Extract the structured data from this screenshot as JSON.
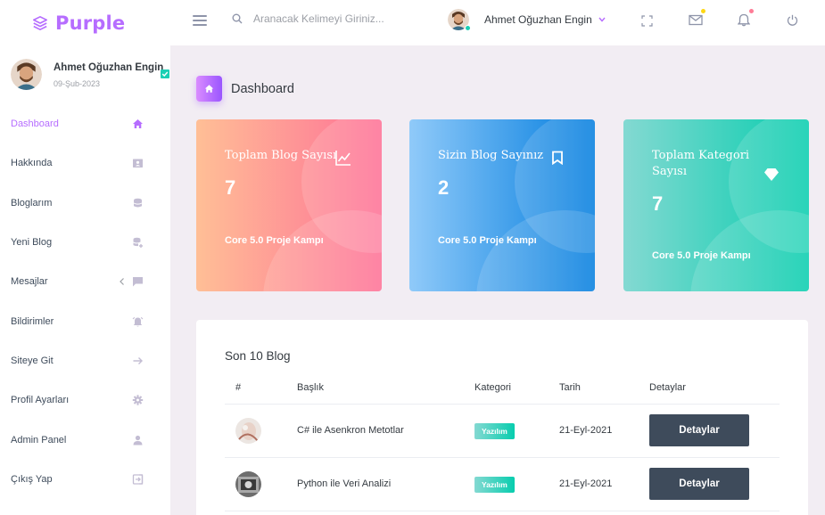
{
  "brand": {
    "name": "Purple",
    "accent": "#b66dff"
  },
  "search": {
    "placeholder": "Aranacak Kelimeyi Giriniz..."
  },
  "user": {
    "name": "Ahmet Oğuzhan Engin",
    "date": "09-Şub-2023"
  },
  "navbar": {
    "icons": [
      "menu-icon",
      "search-icon",
      "fullscreen-icon",
      "mail-icon",
      "bell-icon",
      "power-icon"
    ],
    "mail_badge_color": "#fed713",
    "bell_badge_color": "#fe7c96"
  },
  "sidebar": {
    "items": [
      {
        "label": "Dashboard",
        "icon": "home-icon",
        "active": true
      },
      {
        "label": "Hakkında",
        "icon": "contact-card-icon"
      },
      {
        "label": "Bloglarım",
        "icon": "database-icon"
      },
      {
        "label": "Yeni Blog",
        "icon": "database-plus-icon"
      },
      {
        "label": "Mesajlar",
        "icon": "message-icon"
      },
      {
        "label": "Bildirimler",
        "icon": "alarm-icon"
      },
      {
        "label": "Siteye Git",
        "icon": "arrow-right-icon"
      },
      {
        "label": "Profil Ayarları",
        "icon": "gear-icon"
      },
      {
        "label": "Admin Panel",
        "icon": "user-icon"
      },
      {
        "label": "Çıkış Yap",
        "icon": "logout-icon"
      }
    ]
  },
  "page": {
    "title": "Dashboard"
  },
  "cards": [
    {
      "title": "Toplam Blog Sayısı",
      "value": "7",
      "subtitle": "Core 5.0 Proje Kampı",
      "icon": "chart-line-icon"
    },
    {
      "title": "Sizin Blog Sayınız",
      "value": "2",
      "subtitle": "Core 5.0 Proje Kampı",
      "icon": "bookmark-icon"
    },
    {
      "title": "Toplam Kategori Sayısı",
      "value": "7",
      "subtitle": "Core 5.0 Proje Kampı",
      "icon": "diamond-icon"
    }
  ],
  "table": {
    "title": "Son 10 Blog",
    "headers": [
      "#",
      "Başlık",
      "Kategori",
      "Tarih",
      "Detaylar"
    ],
    "rows": [
      {
        "title": "C# ile Asenkron Metotlar",
        "category": "Yazılım",
        "date": "21-Eyl-2021",
        "action": "Detaylar"
      },
      {
        "title": "Python ile Veri Analizi",
        "category": "Yazılım",
        "date": "21-Eyl-2021",
        "action": "Detaylar"
      }
    ]
  }
}
